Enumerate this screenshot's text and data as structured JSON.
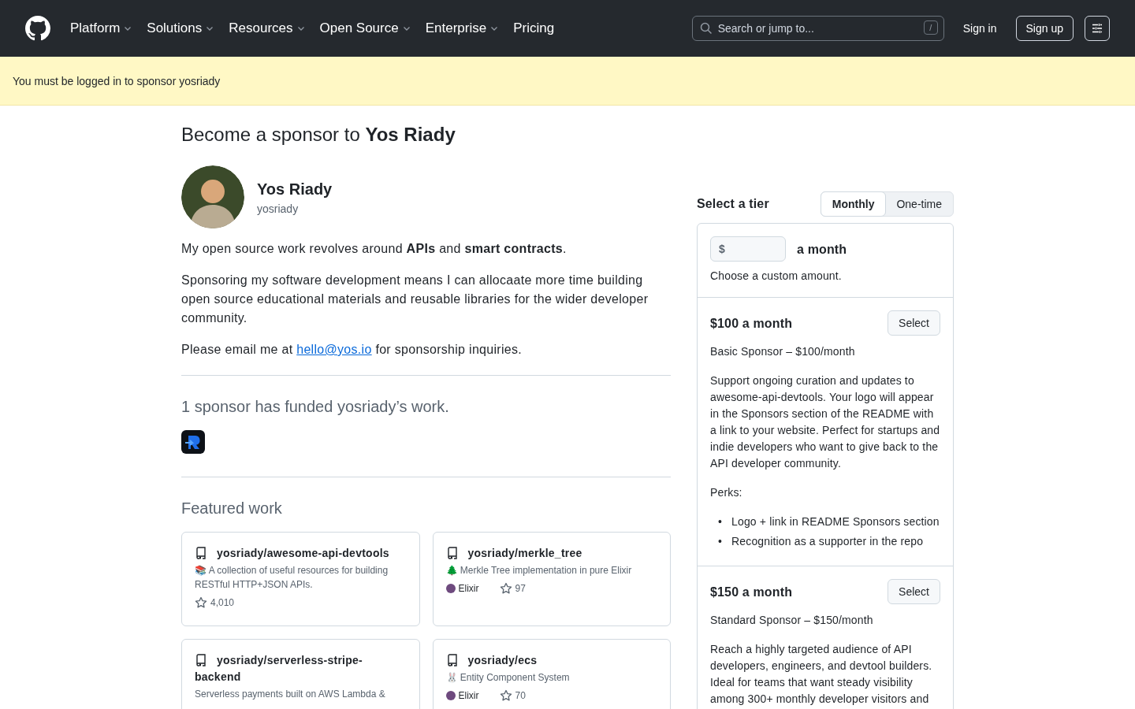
{
  "header": {
    "nav": [
      {
        "label": "Platform",
        "dropdown": true
      },
      {
        "label": "Solutions",
        "dropdown": true
      },
      {
        "label": "Resources",
        "dropdown": true
      },
      {
        "label": "Open Source",
        "dropdown": true
      },
      {
        "label": "Enterprise",
        "dropdown": true
      },
      {
        "label": "Pricing",
        "dropdown": false
      }
    ],
    "search": {
      "placeholder": "Search or jump to...",
      "shortcut": "/"
    },
    "sign_in": "Sign in",
    "sign_up": "Sign up"
  },
  "banner": "You must be logged in to sponsor yosriady",
  "title": "Become a sponsor to **Yos Riady**",
  "profile": {
    "name": "Yos Riady",
    "username": "yosriady",
    "bio": [
      "My open source work revolves around **APIs** and **smart contracts**.",
      "Sponsoring my software development means I can allocaate more time building open source educational materials and reusable libraries for the wider developer community."
    ],
    "contact": {
      "before": "Please email me at",
      "link": "hello@yos.io",
      "after": "for sponsorship inquiries."
    }
  },
  "sponsors": {
    "summary": "1 sponsor has funded yosriady’s work.",
    "logos": [
      {
        "kind": "logo"
      }
    ]
  },
  "featured": {
    "heading": "Featured work",
    "repos": [
      {
        "name": "yosriady/awesome-api-devtools",
        "description": "📚 A collection of useful resources for building RESTful HTTP+JSON APIs.",
        "stars": "4,010"
      },
      {
        "name": "yosriady/merkle_tree",
        "description": "🌲 Merkle Tree implementation in pure Elixir",
        "language": {
          "name": "Elixir",
          "color": "#6e4a7e"
        },
        "stars": "97"
      },
      {
        "name": "yosriady/serverless-stripe-backend",
        "description": "Serverless payments built on AWS Lambda &"
      },
      {
        "name": "yosriady/ecs",
        "description": "🐰 Entity Component System",
        "language": {
          "name": "Elixir",
          "color": "#6e4a7e"
        },
        "stars": "70"
      }
    ]
  },
  "tiers": {
    "heading": "Select a tier",
    "frequency": [
      {
        "label": "Monthly",
        "selected": true
      },
      {
        "label": "One-time",
        "selected": false
      }
    ],
    "items": [
      {
        "kind": "custom",
        "currency": "$",
        "suffix": "a month",
        "note": "Choose a custom amount."
      },
      {
        "kind": "tier",
        "price": "$100 a month",
        "button": "Select",
        "subtitle": "Basic Sponsor – $100/month",
        "description": "Support ongoing curation and updates to awesome-api-devtools. Your logo will appear in the Sponsors section of the README with a link to your website. Perfect for startups and indie developers who want to give back to the API developer community.",
        "perks_label": "Perks:",
        "bullet": "•",
        "perks": [
          "Logo + link in README Sponsors section",
          "Recognition as a supporter in the repo"
        ]
      },
      {
        "kind": "tier",
        "price": "$150 a month",
        "button": "Select",
        "subtitle": "Standard Sponsor – $150/month",
        "description": "Reach a highly targeted audience of API developers, engineers, and devtool builders. Ideal for teams that want steady visibility among 300+ monthly developer visitors and"
      }
    ]
  }
}
